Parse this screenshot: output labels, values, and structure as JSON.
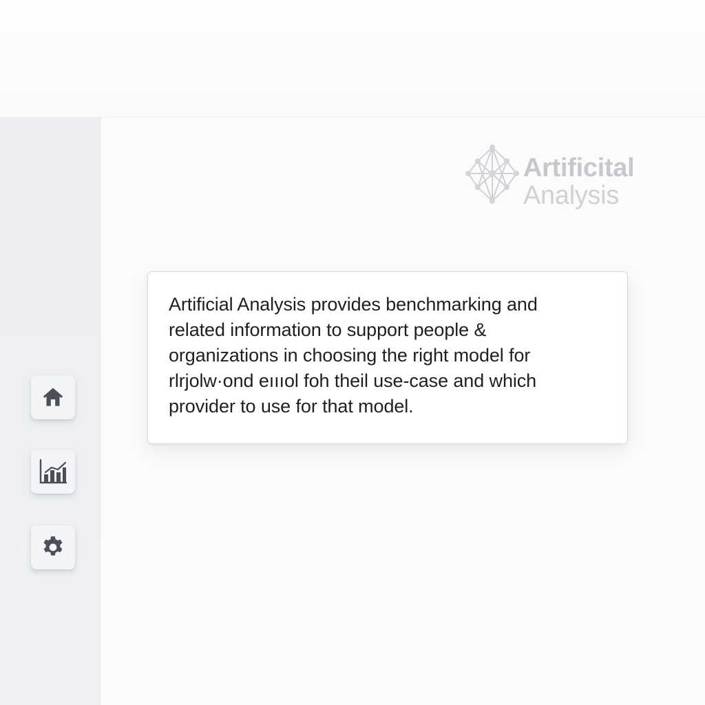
{
  "brand": {
    "line1": "Artificital",
    "line2": "Analysis",
    "icon": "network-logo-icon"
  },
  "sidebar": {
    "items": [
      {
        "icon": "home-icon"
      },
      {
        "icon": "bar-chart-icon"
      },
      {
        "icon": "gear-icon"
      }
    ]
  },
  "card": {
    "lines": [
      "Artificial Analysis provides benchmarking and",
      "related information to support people &",
      "organizations in choosing the right model for",
      "rlrjolw·ond eıııol foh theil use-case and which",
      "provider to use for that model."
    ]
  },
  "colors": {
    "sidebar_bg": "#eceef2",
    "icon": "#4a4f5a",
    "text": "#1e1f24",
    "brand": "#c8cacf"
  }
}
